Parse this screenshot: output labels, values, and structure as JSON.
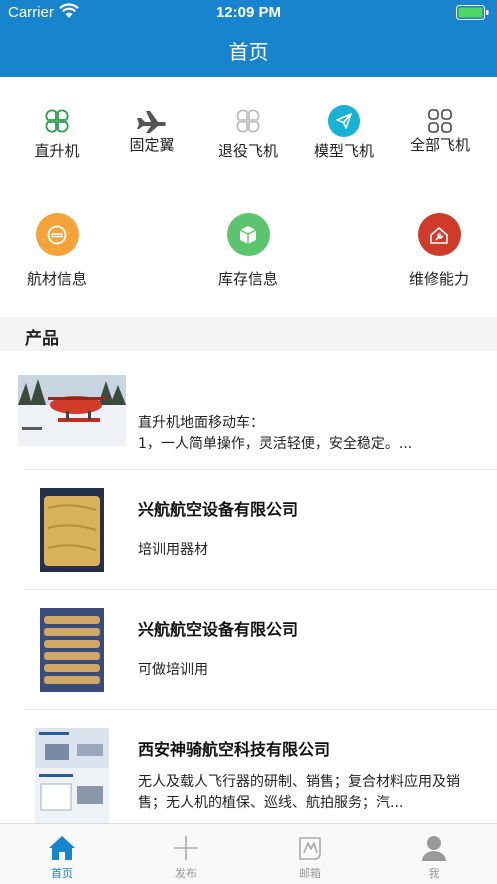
{
  "status": {
    "carrier": "Carrier",
    "time": "12:09 PM"
  },
  "header": {
    "title": "首页"
  },
  "categories": [
    {
      "label": "直升机",
      "icon": "helicopter-clover-icon"
    },
    {
      "label": "固定翼",
      "icon": "airplane-icon"
    },
    {
      "label": "退役飞机",
      "icon": "clover-gray-icon"
    },
    {
      "label": "模型飞机",
      "icon": "paper-plane-icon"
    },
    {
      "label": "全部飞机",
      "icon": "grid-icon"
    }
  ],
  "services": [
    {
      "label": "航材信息",
      "icon": "material-icon",
      "color": "#f3a33a"
    },
    {
      "label": "库存信息",
      "icon": "box-icon",
      "color": "#5cc46e"
    },
    {
      "label": "维修能力",
      "icon": "wrench-icon",
      "color": "#cf3b2a"
    }
  ],
  "section": {
    "title": "产品"
  },
  "products": [
    {
      "name": "",
      "desc": "直升机地面移动车：\n1，一人简单操作，灵活轻便，安全稳定。..."
    },
    {
      "name": "兴航航空设备有限公司",
      "desc": "培训用器材"
    },
    {
      "name": "兴航航空设备有限公司",
      "desc": "可做培训用"
    },
    {
      "name": "西安神骑航空科技有限公司",
      "desc": "无人及载人飞行器的研制、销售；复合材料应用及销售；无人机的植保、巡线、航拍服务；汽..."
    }
  ],
  "tabs": [
    {
      "label": "首页",
      "icon": "home-icon",
      "active": true
    },
    {
      "label": "发布",
      "icon": "plus-icon",
      "active": false
    },
    {
      "label": "邮箱",
      "icon": "mail-icon",
      "active": false
    },
    {
      "label": "我",
      "icon": "user-icon",
      "active": false
    }
  ],
  "colors": {
    "primary": "#1884cd",
    "divider": "#e3e3e3",
    "section_bg": "#f4f4f4"
  }
}
